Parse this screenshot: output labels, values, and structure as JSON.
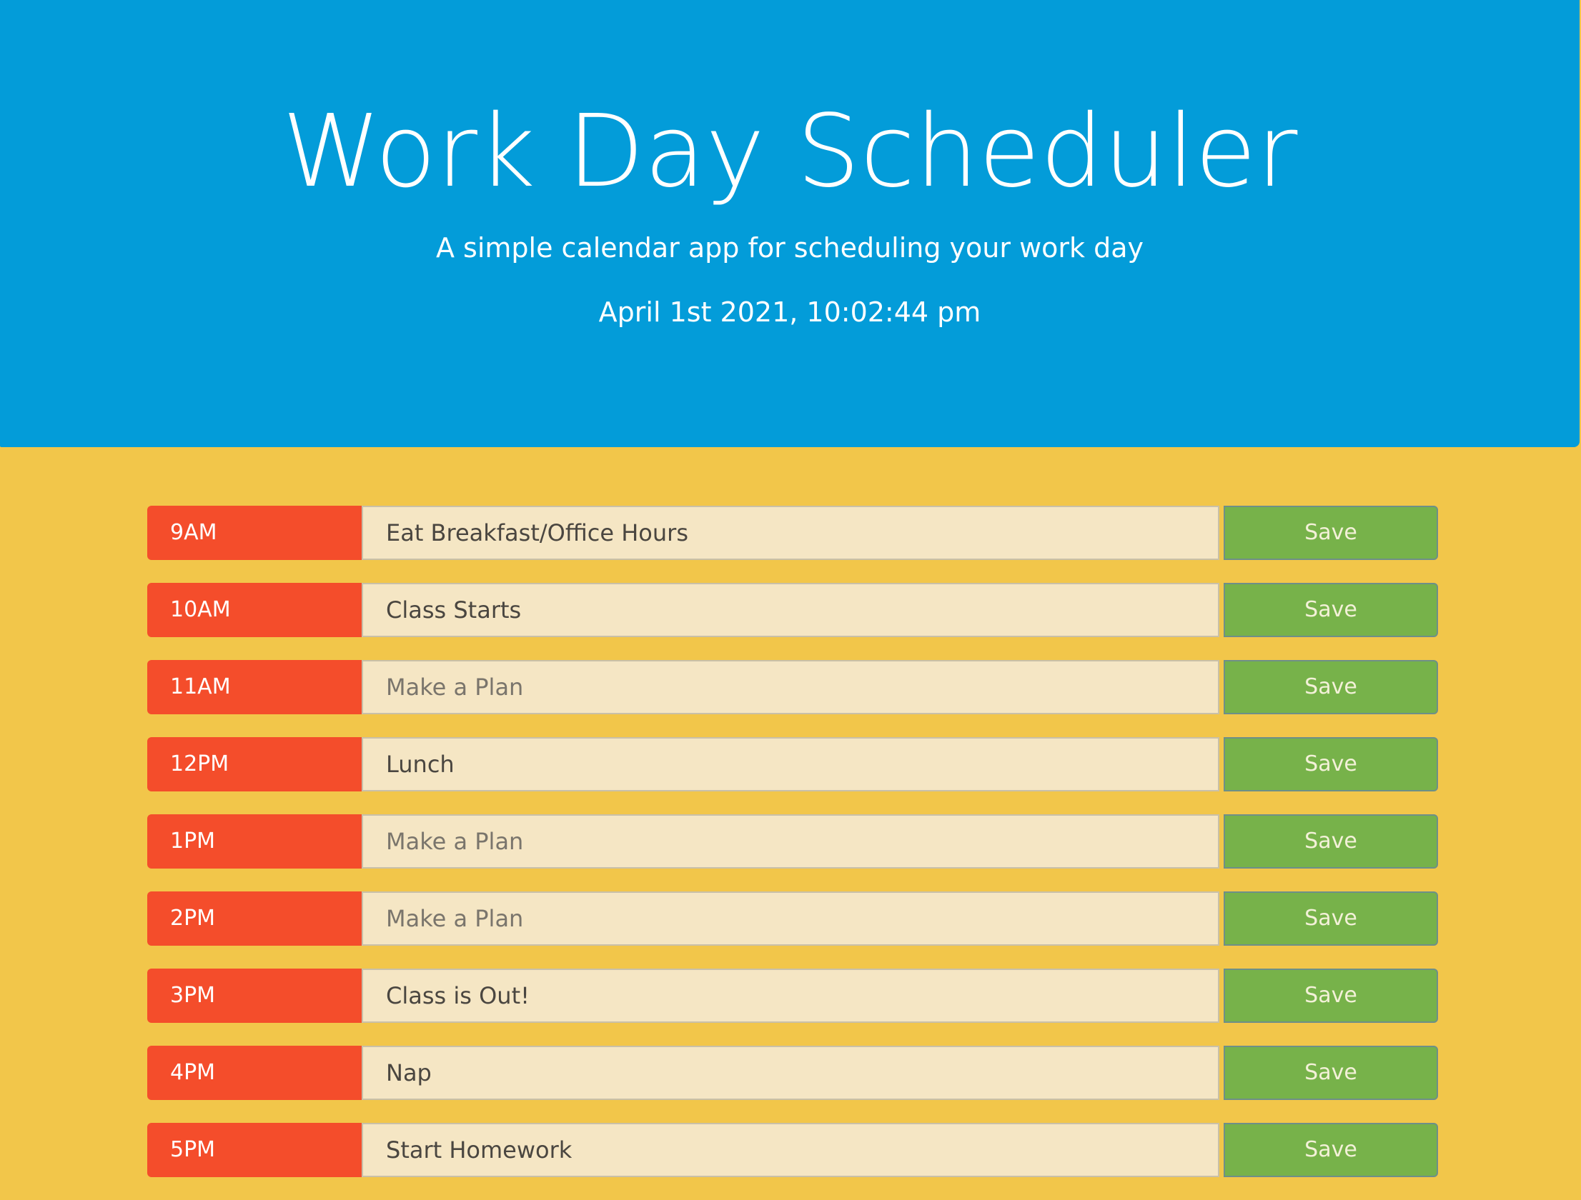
{
  "header": {
    "title": "Work Day Scheduler",
    "subtitle": "A simple calendar app for scheduling your work day",
    "current_datetime": "April 1st 2021, 10:02:44 pm"
  },
  "colors": {
    "header_bg": "#039cd9",
    "page_bg": "#f2c64a",
    "past_hour": "#f44d2b",
    "textarea_bg": "#f5e6c4",
    "save_button": "#77b24a"
  },
  "save_label": "Save",
  "time_blocks": [
    {
      "hour": "9AM",
      "value": "Eat Breakfast/Office Hours",
      "placeholder": ""
    },
    {
      "hour": "10AM",
      "value": "Class Starts",
      "placeholder": ""
    },
    {
      "hour": "11AM",
      "value": "",
      "placeholder": "Make a Plan"
    },
    {
      "hour": "12PM",
      "value": "Lunch",
      "placeholder": ""
    },
    {
      "hour": "1PM",
      "value": "",
      "placeholder": "Make a Plan"
    },
    {
      "hour": "2PM",
      "value": "",
      "placeholder": "Make a Plan"
    },
    {
      "hour": "3PM",
      "value": "Class is Out!",
      "placeholder": ""
    },
    {
      "hour": "4PM",
      "value": "Nap",
      "placeholder": ""
    },
    {
      "hour": "5PM",
      "value": "Start Homework",
      "placeholder": ""
    }
  ]
}
